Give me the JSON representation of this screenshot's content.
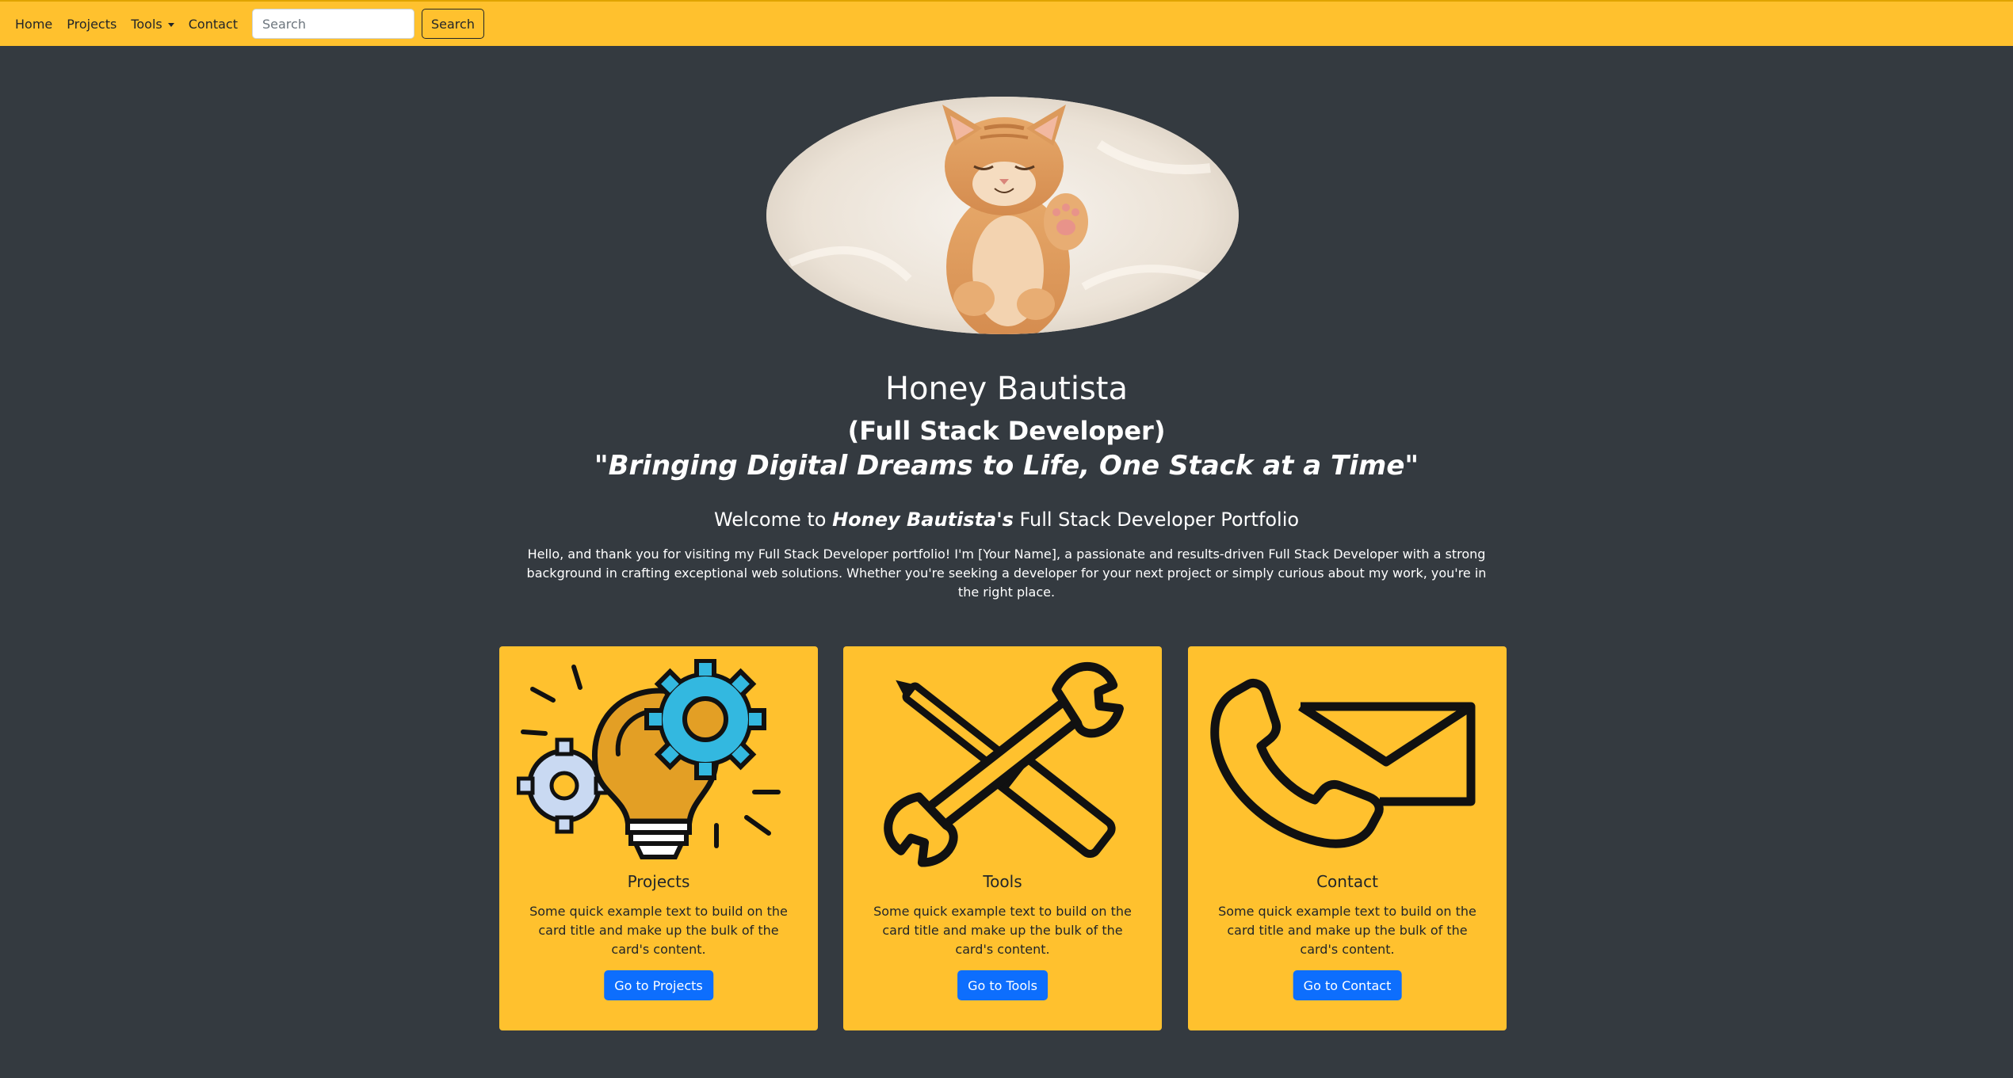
{
  "nav": {
    "items": [
      "Home",
      "Projects",
      "Tools",
      "Contact"
    ],
    "search_placeholder": "Search",
    "search_button": "Search"
  },
  "hero": {
    "name": "Honey Bautista",
    "role": "(Full Stack Developer)",
    "motto": "\"Bringing Digital Dreams to Life, One Stack at a Time\"",
    "welcome_prefix": "Welcome to ",
    "welcome_name": "Honey Bautista's",
    "welcome_suffix": " Full Stack Developer Portfolio",
    "intro": "Hello, and thank you for visiting my Full Stack Developer portfolio! I'm [Your Name], a passionate and results-driven Full Stack Developer with a strong background in crafting exceptional web solutions. Whether you're seeking a developer for your next project or simply curious about my work, you're in the right place."
  },
  "cards": [
    {
      "title": "Projects",
      "text": "Some quick example text to build on the card title and make up the bulk of the card's content.",
      "button": "Go to Projects",
      "icon": "lightbulb-gears-icon"
    },
    {
      "title": "Tools",
      "text": "Some quick example text to build on the card title and make up the bulk of the card's content.",
      "button": "Go to Tools",
      "icon": "wrench-screwdriver-icon"
    },
    {
      "title": "Contact",
      "text": "Some quick example text to build on the card title and make up the bulk of the card's content.",
      "button": "Go to Contact",
      "icon": "phone-envelope-icon"
    }
  ],
  "colors": {
    "navbar": "#ffc12e",
    "background": "#343a40",
    "card": "#ffc12e",
    "button": "#0d6efd"
  }
}
